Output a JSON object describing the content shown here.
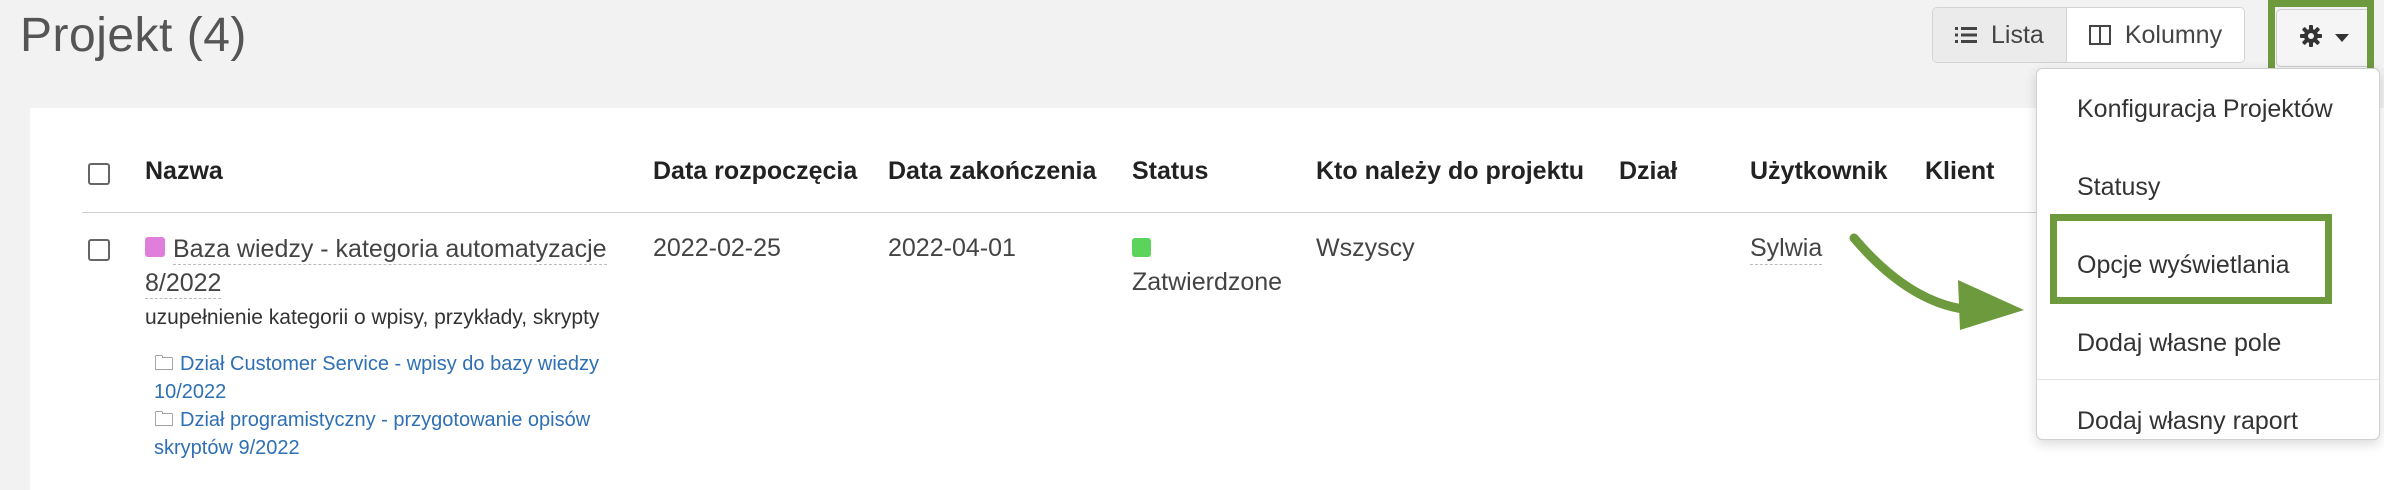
{
  "page": {
    "title": "Projekt (4)"
  },
  "toolbar": {
    "list_label": "Lista",
    "columns_label": "Kolumny",
    "settings_icon": "gear-icon",
    "caret_icon": "caret-down-icon"
  },
  "table": {
    "headers": [
      "Nazwa",
      "Data rozpoczęcia",
      "Data zakończenia",
      "Status",
      "Kto należy do projektu",
      "Dział",
      "Użytkownik",
      "Klient"
    ],
    "rows": [
      {
        "name_line1": "Baza wiedzy - kategoria automatyzacje",
        "name_line2": "8/2022",
        "color": "#e07fdb",
        "description": "uzupełnienie kategorii o wpisy, przykłady, skrypty",
        "subprojects": [
          {
            "line1": "Dział Customer Service - wpisy do bazy wiedzy",
            "line2": "10/2022"
          },
          {
            "line1": "Dział programistyczny - przygotowanie opisów",
            "line2": "skryptów 9/2022"
          }
        ],
        "start_date": "2022-02-25",
        "end_date": "2022-04-01",
        "status": "Zatwierdzone",
        "status_color": "#5cd45c",
        "members": "Wszyscy",
        "department": "",
        "user": "Sylwia",
        "client": ""
      }
    ]
  },
  "dropdown": {
    "items": [
      "Konfiguracja Projektów",
      "Statusy",
      "Opcje wyświetlania",
      "Dodaj własne pole",
      "Dodaj własny raport"
    ]
  },
  "colors": {
    "highlight": "#6e9a3e",
    "link": "#2f6fb3"
  }
}
